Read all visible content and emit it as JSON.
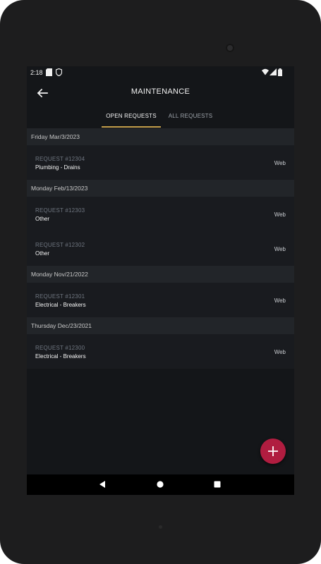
{
  "status_bar": {
    "time": "2:18"
  },
  "app_bar": {
    "title": "MAINTENANCE",
    "back_icon": "arrow-left-icon"
  },
  "tabs": [
    {
      "label": "OPEN REQUESTS",
      "active": true
    },
    {
      "label": "ALL REQUESTS",
      "active": false
    }
  ],
  "groups": [
    {
      "date": "Friday Mar/3/2023",
      "items": [
        {
          "number": "REQUEST #12304",
          "category": "Plumbing - Drains",
          "source": "Web"
        }
      ]
    },
    {
      "date": "Monday Feb/13/2023",
      "items": [
        {
          "number": "REQUEST #12303",
          "category": "Other",
          "source": "Web"
        },
        {
          "number": "REQUEST #12302",
          "category": "Other",
          "source": "Web"
        }
      ]
    },
    {
      "date": "Monday Nov/21/2022",
      "items": [
        {
          "number": "REQUEST #12301",
          "category": "Electrical - Breakers",
          "source": "Web"
        }
      ]
    },
    {
      "date": "Thursday Dec/23/2021",
      "items": [
        {
          "number": "REQUEST #12300",
          "category": "Electrical - Breakers",
          "source": "Web"
        }
      ]
    }
  ],
  "fab": {
    "icon": "plus-icon"
  },
  "colors": {
    "background": "#141619",
    "header_band": "#222529",
    "accent_tab": "#c29d4a",
    "fab": "#b01d40"
  }
}
